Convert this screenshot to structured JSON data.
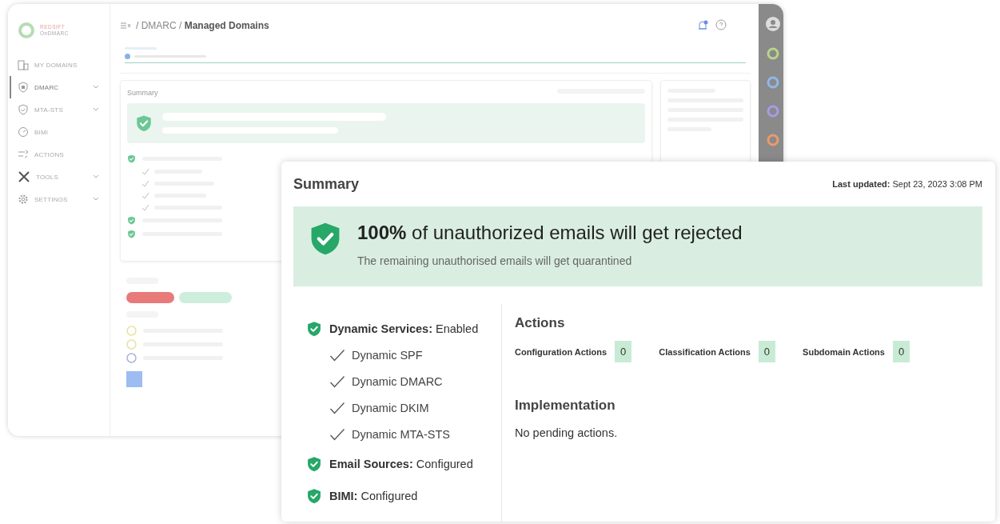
{
  "app": {
    "logo": {
      "top": "REDSIFT",
      "bottom": "OnDMARC"
    },
    "sidebar": {
      "items": [
        {
          "label": "MY DOMAINS",
          "expandable": false,
          "selected": false
        },
        {
          "label": "DMARC",
          "expandable": true,
          "selected": true
        },
        {
          "label": "MTA-STS",
          "expandable": true,
          "selected": false
        },
        {
          "label": "BIMI",
          "expandable": false,
          "selected": false
        },
        {
          "label": "ACTIONS",
          "expandable": false,
          "selected": false
        },
        {
          "label": "TOOLS",
          "expandable": true,
          "selected": false
        },
        {
          "label": "SETTINGS",
          "expandable": true,
          "selected": false
        }
      ]
    },
    "breadcrumb": "/ DMARC / **Managed Domains**",
    "panel_title": "Summary",
    "rail_apps": [
      {
        "color": "#b9d48a"
      },
      {
        "color": "#8fb8e8"
      },
      {
        "color": "#a99be6"
      },
      {
        "color": "#eb9a6c"
      }
    ]
  },
  "summary_card": {
    "title": "Summary",
    "last_updated": "**Last updated:** Sept 23, 2023 3:08 PM",
    "banner": {
      "headline": "**100%** of unauthorized emails will get rejected",
      "subtext": "The remaining unauthorised emails will get quarantined"
    },
    "services": [
      {
        "text": "**Dynamic Services:** Enabled",
        "children": [
          "Dynamic SPF",
          "Dynamic DMARC",
          "Dynamic DKIM",
          "Dynamic MTA-STS"
        ]
      },
      {
        "text": "**Email Sources:** Configured"
      },
      {
        "text": "**BIMI:** Configured"
      }
    ],
    "actions": {
      "title": "Actions",
      "counters": [
        {
          "label": "Configuration Actions",
          "count": "0"
        },
        {
          "label": "Classification Actions",
          "count": "0"
        },
        {
          "label": "Subdomain Actions",
          "count": "0"
        }
      ]
    },
    "implementation": {
      "title": "Implementation",
      "text": "No pending actions."
    }
  }
}
